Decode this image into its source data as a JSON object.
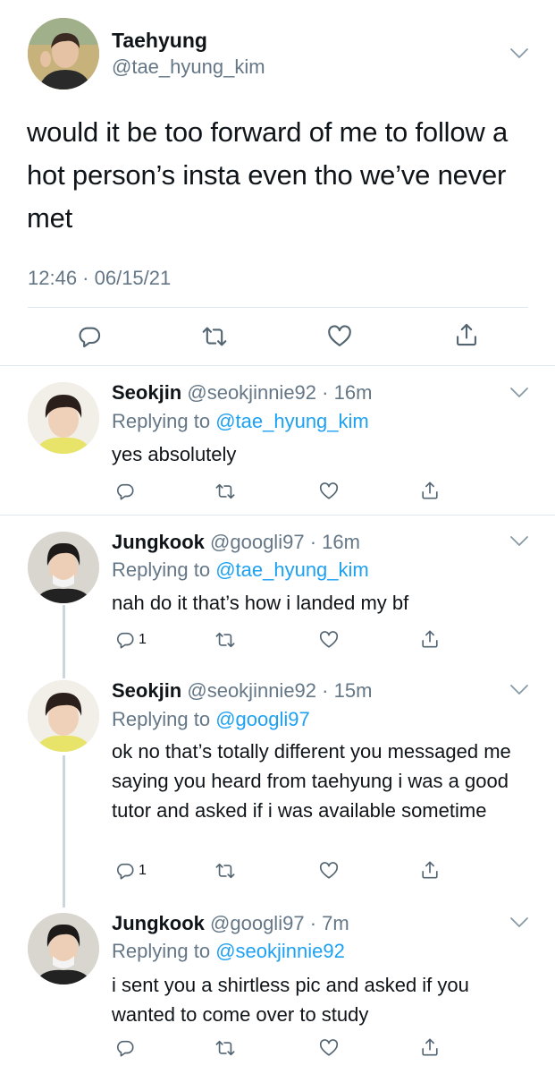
{
  "main_tweet": {
    "name": "Taehyung",
    "handle": "@tae_hyung_kim",
    "text": "would it be too forward of me to follow a hot person’s insta even tho we’ve never met",
    "timestamp": "12:46 · 06/15/21"
  },
  "replies": [
    {
      "name": "Seokjin",
      "handle": "@seokjinnie92",
      "time": "· 16m",
      "replying_prefix": "Replying to",
      "replying_to": "@tae_hyung_kim",
      "text": "yes absolutely",
      "reply_count": ""
    },
    {
      "name": "Jungkook",
      "handle": "@googli97",
      "time": "· 16m",
      "replying_prefix": "Replying to",
      "replying_to": "@tae_hyung_kim",
      "text": "nah do it that’s how i landed my bf",
      "reply_count": "1"
    },
    {
      "name": "Seokjin",
      "handle": "@seokjinnie92",
      "time": "· 15m",
      "replying_prefix": "Replying to",
      "replying_to": "@googli97",
      "text": "ok no that’s totally different you messaged me saying you heard from taehyung i was a good tutor and asked if i was available sometime",
      "reply_count": "1"
    },
    {
      "name": "Jungkook",
      "handle": "@googli97",
      "time": "· 7m",
      "replying_prefix": "Replying to",
      "replying_to": "@seokjinnie92",
      "text": "i sent you a shirtless pic and asked if you wanted to come over to study",
      "reply_count": ""
    }
  ],
  "icons": [
    "chevron-down-icon",
    "reply-icon",
    "retweet-icon",
    "like-icon",
    "share-icon"
  ],
  "colors": {
    "link": "#1da1f2",
    "secondary": "#657786",
    "text": "#0f1419",
    "divider": "#e1e8ed"
  }
}
